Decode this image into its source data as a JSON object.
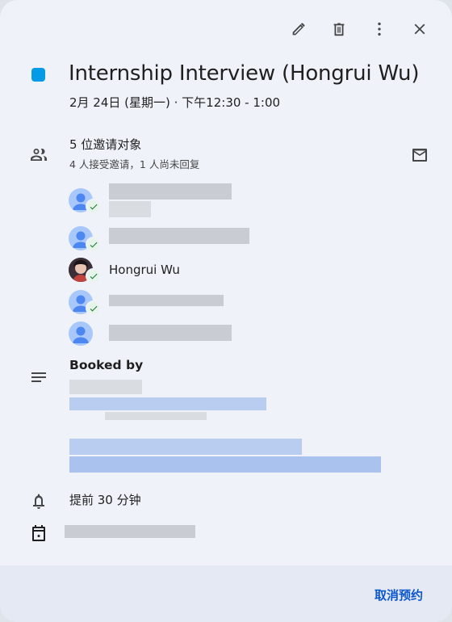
{
  "event": {
    "title": "Internship Interview (Hongrui Wu)",
    "datetime": "2月 24日 (星期一)  ·  下午12:30 - 1:00",
    "color": "#039be5"
  },
  "toolbar": {
    "edit_icon": "pencil-icon",
    "delete_icon": "trash-icon",
    "more_icon": "more-vert-icon",
    "close_icon": "close-icon"
  },
  "guests": {
    "title": "5 位邀请对象",
    "summary": "4 人接受邀请，1 人尚未回复",
    "list": [
      {
        "name": "",
        "status": "accepted"
      },
      {
        "name": "",
        "status": "accepted"
      },
      {
        "name": "Hongrui Wu",
        "status": "accepted"
      },
      {
        "name": "",
        "status": "accepted"
      },
      {
        "name": "",
        "status": "pending"
      }
    ]
  },
  "description": {
    "heading": "Booked by"
  },
  "reminder": {
    "text": "提前 30 分钟"
  },
  "footer": {
    "cancel_label": "取消预约",
    "accent": "#0b57d0"
  }
}
